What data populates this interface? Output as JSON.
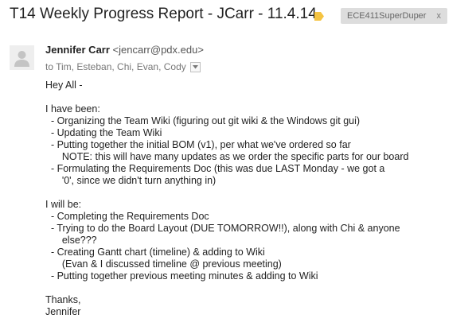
{
  "email": {
    "subject": "T14 Weekly Progress Report - JCarr - 11.4.14",
    "label": "ECE411SuperDuper",
    "label_remove": "x",
    "sender_name": "Jennifer Carr",
    "sender_email": "<jencarr@pdx.edu>",
    "recipients": "to Tim, Esteban, Chi, Evan, Cody",
    "body_lines": [
      "Hey All -",
      "",
      "I have been:",
      "  - Organizing the Team Wiki (figuring out git wiki & the Windows git gui)",
      "  - Updating the Team Wiki",
      "  - Putting together the initial BOM (v1), per what we've ordered so far",
      "      NOTE: this will have many updates as we order the specific parts for our board",
      "  - Formulating the Requirements Doc (this was due LAST Monday - we got a",
      "      '0', since we didn't turn anything in)",
      "",
      "I will be:",
      "  - Completing the Requirements Doc",
      "  - Trying to do the Board Layout (DUE TOMORROW!!), along with Chi & anyone",
      "      else???",
      "  - Creating Gantt chart (timeline) & adding to Wiki",
      "      (Evan & I discussed timeline @ previous meeting)",
      "  - Putting together previous meeting minutes & adding to Wiki",
      "",
      "Thanks,",
      "Jennifer"
    ]
  },
  "colors": {
    "label_tag": "#f5c442",
    "chip_bg": "#dddddd",
    "avatar_bg": "#eeeeee",
    "avatar_fg": "#c4c4c4"
  },
  "icons": {
    "label_tag": "label-tag-icon",
    "avatar": "default-avatar-icon",
    "dropdown": "chevron-down-icon"
  }
}
